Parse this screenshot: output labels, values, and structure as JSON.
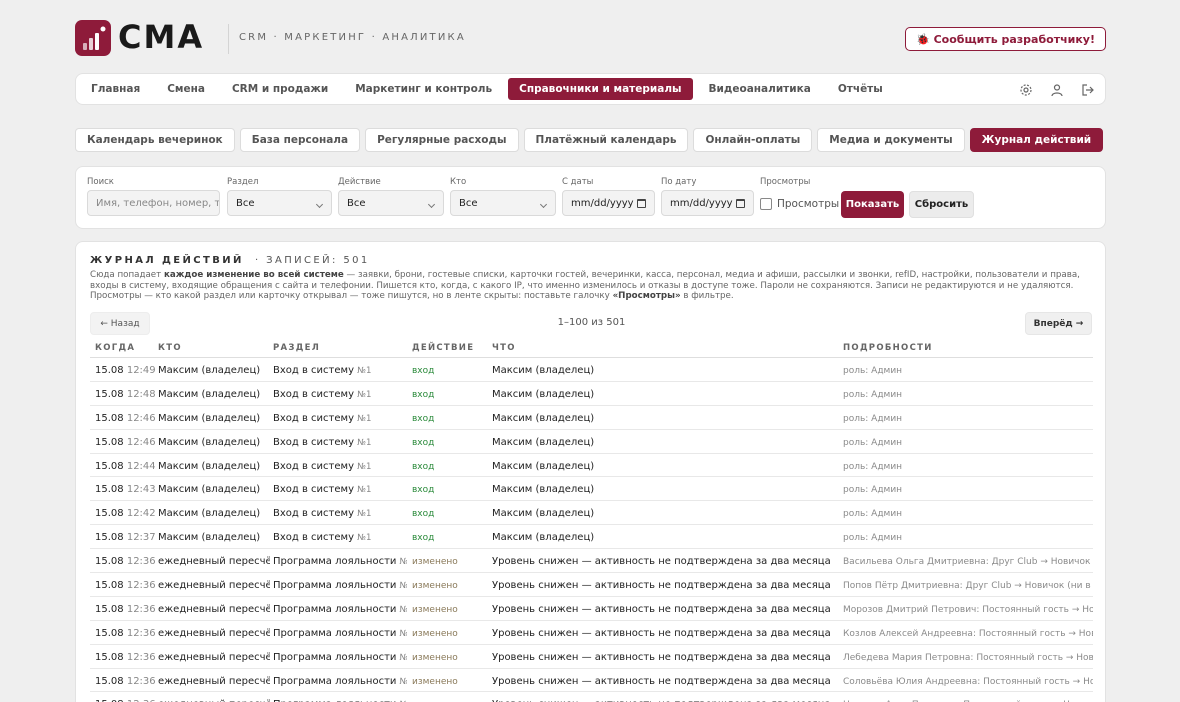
{
  "brand": {
    "name": "CMA",
    "tagline": "CRM · МАРКЕТИНГ · АНАЛИТИКА",
    "accent": "#8e1b3a"
  },
  "header": {
    "report_button": "🐞 Сообщить разработчику!"
  },
  "nav": {
    "tabs": [
      "Главная",
      "Смена",
      "CRM и продажи",
      "Маркетинг и контроль",
      "Справочники и материалы",
      "Видеоаналитика",
      "Отчёты"
    ],
    "active": "Справочники и материалы",
    "icons": [
      "gear-icon",
      "user-icon",
      "logout-icon"
    ]
  },
  "subtabs": {
    "items": [
      "Календарь вечеринок",
      "База персонала",
      "Регулярные расходы",
      "Платёжный календарь",
      "Онлайн-оплаты",
      "Медиа и документы",
      "Журнал действий"
    ],
    "active": "Журнал действий"
  },
  "filters": {
    "search": {
      "label": "Поиск",
      "placeholder": "Имя, телефон, номер, текст"
    },
    "section": {
      "label": "Раздел",
      "value": "Все"
    },
    "action": {
      "label": "Действие",
      "value": "Все"
    },
    "who": {
      "label": "Кто",
      "value": "Все"
    },
    "date_from": {
      "label": "С даты",
      "placeholder": "mm/dd/yyyy"
    },
    "date_to": {
      "label": "По дату",
      "placeholder": "mm/dd/yyyy"
    },
    "views": {
      "label": "Просмотры",
      "checkbox_label": "Просмотры",
      "checked": false
    },
    "show_button": "Показать",
    "reset_button": "Сбросить"
  },
  "log": {
    "title": "ЖУРНАЛ ДЕЙСТВИЙ",
    "count_label": "· ЗАПИСЕЙ: 501",
    "desc": {
      "p1": "Сюда попадает ",
      "b1": "каждое изменение во всей системе",
      "p2": " — заявки, брони, гостевые списки, карточки гостей, вечеринки, касса, персонал, медиа и афиши, рассылки и звонки, refID, настройки, пользователи и права, входы в систему, входящие обращения с сайта и телефонии. Пишется кто, когда, с какого IP, что именно изменилось и отказы в доступе тоже. Пароли не сохраняются. Записи не редактируются и не удаляются. Просмотры — кто какой раздел или карточку открывал — тоже пишутся, но в ленте скрыты: поставьте галочку ",
      "b2": "«Просмотры»",
      "p3": " в фильтре."
    },
    "pager": {
      "prev": "← Назад",
      "info": "1–100 из 501",
      "next": "Вперёд →"
    },
    "columns": [
      "КОГДА",
      "КТО",
      "РАЗДЕЛ",
      "ДЕЙСТВИЕ",
      "ЧТО",
      "ПОДРОБНОСТИ"
    ],
    "rows": [
      {
        "date": "15.08",
        "time": "12:49",
        "who": "Максим (владелец)",
        "section": "Вход в систему",
        "num": "№1",
        "action": "вход",
        "kind": "in",
        "what": "Максим (владелец)",
        "details": "роль: Админ"
      },
      {
        "date": "15.08",
        "time": "12:48",
        "who": "Максим (владелец)",
        "section": "Вход в систему",
        "num": "№1",
        "action": "вход",
        "kind": "in",
        "what": "Максим (владелец)",
        "details": "роль: Админ"
      },
      {
        "date": "15.08",
        "time": "12:46",
        "who": "Максим (владелец)",
        "section": "Вход в систему",
        "num": "№1",
        "action": "вход",
        "kind": "in",
        "what": "Максим (владелец)",
        "details": "роль: Админ"
      },
      {
        "date": "15.08",
        "time": "12:46",
        "who": "Максим (владелец)",
        "section": "Вход в систему",
        "num": "№1",
        "action": "вход",
        "kind": "in",
        "what": "Максим (владелец)",
        "details": "роль: Админ"
      },
      {
        "date": "15.08",
        "time": "12:44",
        "who": "Максим (владелец)",
        "section": "Вход в систему",
        "num": "№1",
        "action": "вход",
        "kind": "in",
        "what": "Максим (владелец)",
        "details": "роль: Админ"
      },
      {
        "date": "15.08",
        "time": "12:43",
        "who": "Максим (владелец)",
        "section": "Вход в систему",
        "num": "№1",
        "action": "вход",
        "kind": "in",
        "what": "Максим (владелец)",
        "details": "роль: Админ"
      },
      {
        "date": "15.08",
        "time": "12:42",
        "who": "Максим (владелец)",
        "section": "Вход в систему",
        "num": "№1",
        "action": "вход",
        "kind": "in",
        "what": "Максим (владелец)",
        "details": "роль: Админ"
      },
      {
        "date": "15.08",
        "time": "12:37",
        "who": "Максим (владелец)",
        "section": "Вход в систему",
        "num": "№1",
        "action": "вход",
        "kind": "in",
        "what": "Максим (владелец)",
        "details": "роль: Админ"
      },
      {
        "date": "15.08",
        "time": "12:36",
        "who": "ежедневный пересчёт",
        "section": "Программа лояльности",
        "num": "№20",
        "action": "изменено",
        "kind": "ch",
        "what": "Уровень снижен — активность не подтверждена за два месяца",
        "details": "Васильева Ольга Дмитриевна: Друг Club → Новичок (ни в этом"
      },
      {
        "date": "15.08",
        "time": "12:36",
        "who": "ежедневный пересчёт",
        "section": "Программа лояльности",
        "num": "№10",
        "action": "изменено",
        "kind": "ch",
        "what": "Уровень снижен — активность не подтверждена за два месяца",
        "details": "Попов Пётр Дмитриевна: Друг Club → Новичок (ни в этом"
      },
      {
        "date": "15.08",
        "time": "12:36",
        "who": "ежедневный пересчёт",
        "section": "Программа лояльности",
        "num": "№28",
        "action": "изменено",
        "kind": "ch",
        "what": "Уровень снижен — активность не подтверждена за два месяца",
        "details": "Морозов Дмитрий Петрович: Постоянный гость → Новичок"
      },
      {
        "date": "15.08",
        "time": "12:36",
        "who": "ежедневный пересчёт",
        "section": "Программа лояльности",
        "num": "№19",
        "action": "изменено",
        "kind": "ch",
        "what": "Уровень снижен — активность не подтверждена за два месяца",
        "details": "Козлов Алексей Андреевна: Постоянный гость → Новичок"
      },
      {
        "date": "15.08",
        "time": "12:36",
        "who": "ежедневный пересчёт",
        "section": "Программа лояльности",
        "num": "№18",
        "action": "изменено",
        "kind": "ch",
        "what": "Уровень снижен — активность не подтверждена за два месяца",
        "details": "Лебедева Мария Петровна: Постоянный гость → Новичок"
      },
      {
        "date": "15.08",
        "time": "12:36",
        "who": "ежедневный пересчёт",
        "section": "Программа лояльности",
        "num": "№9",
        "action": "изменено",
        "kind": "ch",
        "what": "Уровень снижен — активность не подтверждена за два месяца",
        "details": "Соловьёва Юлия Андреевна: Постоянный гость → Новичок"
      },
      {
        "date": "15.08",
        "time": "12:36",
        "who": "ежедневный пересчёт",
        "section": "Программа лояльности",
        "num": "№8",
        "action": "изменено",
        "kind": "ch",
        "what": "Уровень снижен — активность не подтверждена за два месяца",
        "details": "Новиков Анна Петровна: Постоянный гость → Новичок"
      }
    ]
  }
}
